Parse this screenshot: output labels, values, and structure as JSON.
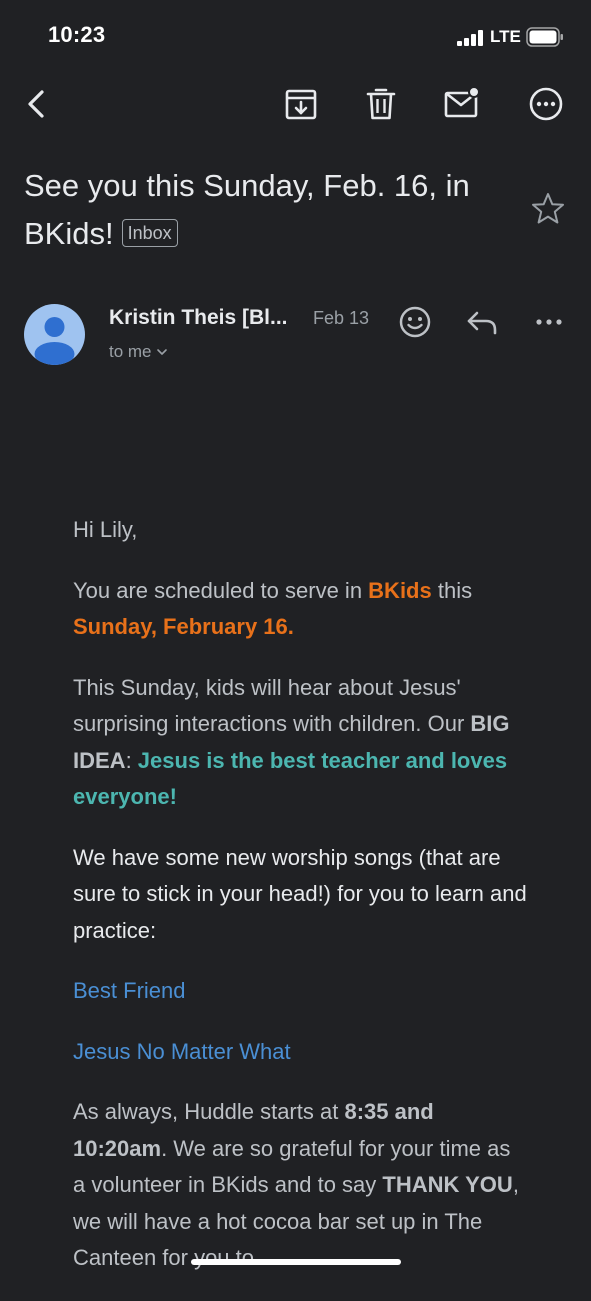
{
  "status_bar": {
    "time": "10:23",
    "network": "LTE"
  },
  "toolbar": {
    "icons": [
      "back-icon",
      "archive-icon",
      "trash-icon",
      "mark-unread-icon",
      "more-icon"
    ]
  },
  "email": {
    "subject": "See you this Sunday, Feb. 16, in BKids!",
    "label": "Inbox",
    "sender": "Kristin Theis [Bl...",
    "date": "Feb 13",
    "recipient": "to me"
  },
  "body": {
    "greeting": "Hi Lily,",
    "p1_a": "You are scheduled to serve in ",
    "p1_b": "BKids",
    "p1_c": " this ",
    "p1_d": "Sunday, February 16.",
    "p2_a": "This Sunday, kids will hear about Jesus' surprising interactions with children. Our ",
    "p2_b": "BIG IDEA",
    "p2_c": ": ",
    "p2_d": "Jesus is the best teacher and loves everyone!",
    "p3": "We have some new worship songs (that are sure to stick in your head!) for you to learn and practice:",
    "link1": "Best Friend",
    "link2": "Jesus No Matter What",
    "p4_a": "As always, Huddle starts at ",
    "p4_b": "8:35 and 10:20am",
    "p4_c": ". We are so grateful for your time as a volunteer in BKids and to say ",
    "p4_d": "THANK YOU",
    "p4_e": ", we will have a hot cocoa bar set up in The Canteen for you to"
  },
  "colors": {
    "background": "#202124",
    "accent_orange": "#e8711a",
    "accent_teal": "#4cb6b0",
    "link": "#4a8fd4"
  }
}
